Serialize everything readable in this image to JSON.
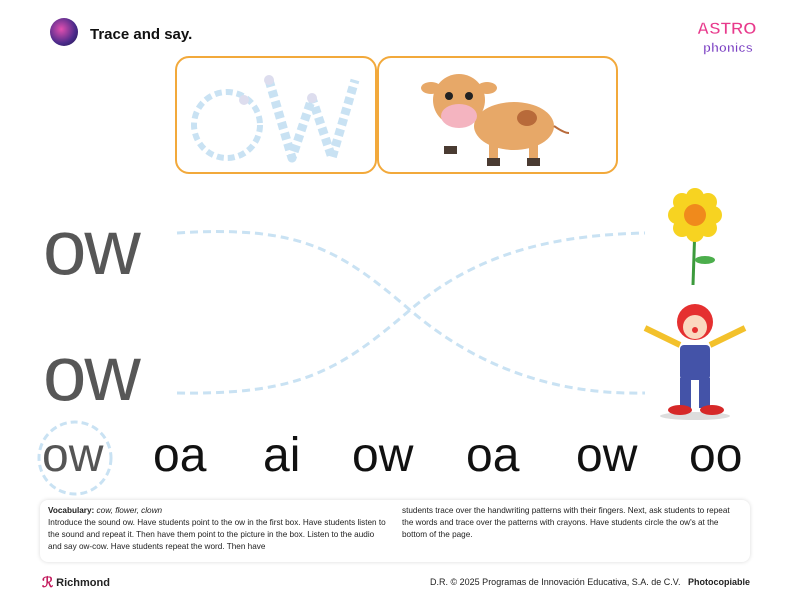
{
  "header": {
    "title": "Trace and say.",
    "logo_text": "ASTRO phonics"
  },
  "trace_box": {
    "letters": "ow"
  },
  "rows": [
    {
      "text": "ow"
    },
    {
      "text": "ow"
    }
  ],
  "choices": [
    "ow",
    "oa",
    "ai",
    "ow",
    "oa",
    "ow",
    "oo"
  ],
  "notes": {
    "vocab_label": "Vocabulary:",
    "vocab_words": "cow, flower, clown",
    "col1": "Introduce the sound ow. Have students point to the ow in the first box. Have students listen to the sound and repeat it. Then have them point to the picture in the box. Listen to the audio and say ow-cow. Have students repeat the word. Then have",
    "col2": "students trace over the handwriting patterns with their fingers. Next, ask students to repeat the words and trace over the patterns with crayons. Have students circle the ow's at the bottom of the page."
  },
  "footer": {
    "brand": "Richmond",
    "copyright": "D.R. © 2025 Programas de Innovación Educativa, S.A. de C.V.",
    "photocopiable": "Photocopiable"
  },
  "colors": {
    "accent": "#f2a93b",
    "trace": "#c9e2f3",
    "text_gray": "#575757"
  }
}
